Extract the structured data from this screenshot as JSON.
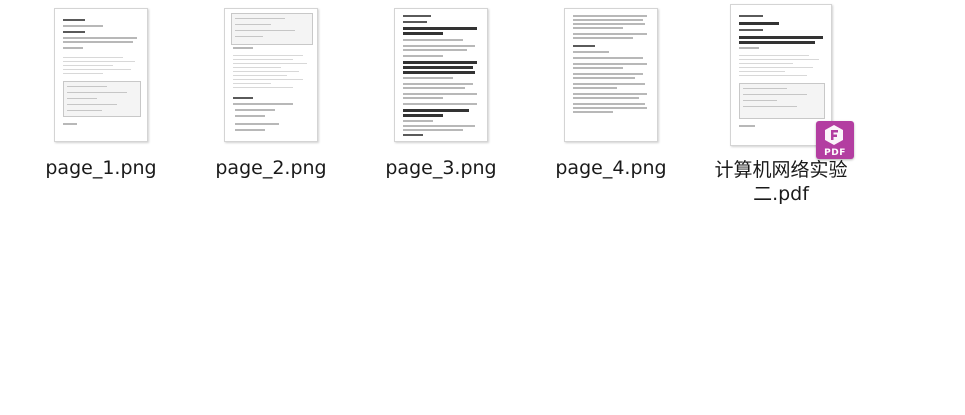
{
  "files": [
    {
      "name": "page_1.png",
      "type": "png"
    },
    {
      "name": "page_2.png",
      "type": "png"
    },
    {
      "name": "page_3.png",
      "type": "png"
    },
    {
      "name": "page_4.png",
      "type": "png"
    },
    {
      "name_line1": "计算机网络实验",
      "name_line2": "二.pdf",
      "type": "pdf"
    }
  ],
  "pdf_badge": {
    "label": "PDF",
    "color": "#b33ea1",
    "icon": "foxit-pdf-icon"
  }
}
